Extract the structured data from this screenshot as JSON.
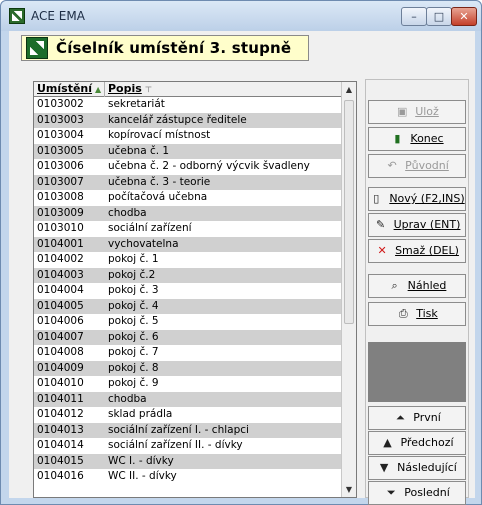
{
  "window": {
    "title": "ACE EMA"
  },
  "header": {
    "title": "Číselník umístění 3. stupně"
  },
  "grid": {
    "columns": [
      "Umístění",
      "Popis"
    ],
    "rows": [
      [
        "0103002",
        "sekretariát"
      ],
      [
        "0103003",
        "kancelář zástupce ředitele"
      ],
      [
        "0103004",
        "kopírovací místnost"
      ],
      [
        "0103005",
        "učebna č. 1"
      ],
      [
        "0103006",
        "učebna č. 2 - odborný výcvik švadleny"
      ],
      [
        "0103007",
        "učebna č. 3 - teorie"
      ],
      [
        "0103008",
        "počítačová učebna"
      ],
      [
        "0103009",
        "chodba"
      ],
      [
        "0103010",
        "sociální zařízení"
      ],
      [
        "0104001",
        "vychovatelna"
      ],
      [
        "0104002",
        "pokoj č. 1"
      ],
      [
        "0104003",
        "pokoj č.2"
      ],
      [
        "0104004",
        "pokoj č. 3"
      ],
      [
        "0104005",
        "pokoj č. 4"
      ],
      [
        "0104006",
        "pokoj č. 5"
      ],
      [
        "0104007",
        "pokoj č. 6"
      ],
      [
        "0104008",
        "pokoj č. 7"
      ],
      [
        "0104009",
        "pokoj č. 8"
      ],
      [
        "0104010",
        "pokoj č. 9"
      ],
      [
        "0104011",
        "chodba"
      ],
      [
        "0104012",
        "sklad prádla"
      ],
      [
        "0104013",
        "sociální zařízení I. - chlapci"
      ],
      [
        "0104014",
        "sociální zařízení II. - dívky"
      ],
      [
        "0104015",
        "WC I. - dívky"
      ],
      [
        "0104016",
        "WC II. -  dívky"
      ]
    ]
  },
  "buttons": {
    "uloz": "Ulož",
    "konec": "Konec",
    "puvodni": "Původní",
    "novy": "Nový (F2,INS)",
    "uprav": "Uprav (ENT)",
    "smaz": "Smaž (DEL)",
    "nahled": "Náhled",
    "tisk": "Tisk",
    "prvni": "První",
    "predchozi": "Předchozí",
    "nasledujici": "Následující",
    "posledni": "Poslední"
  }
}
